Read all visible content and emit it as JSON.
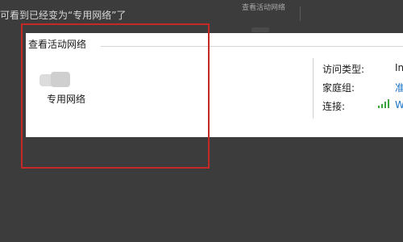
{
  "caption": "可看到已经变为“专用网络”了",
  "background_window": {
    "title": "查看活动网络"
  },
  "panel": {
    "title": "查看活动网络",
    "network_name": "专用网络",
    "properties": [
      {
        "label": "访问类型:",
        "value": "In"
      },
      {
        "label": "家庭组:",
        "value": "准"
      },
      {
        "label": "连接:",
        "value": "W"
      }
    ]
  },
  "icons": {
    "network": "network-icon",
    "signal": "wifi-signal-icon"
  },
  "colors": {
    "highlight": "#c62828",
    "link": "#1a73c8",
    "signal": "#3aa43a"
  }
}
